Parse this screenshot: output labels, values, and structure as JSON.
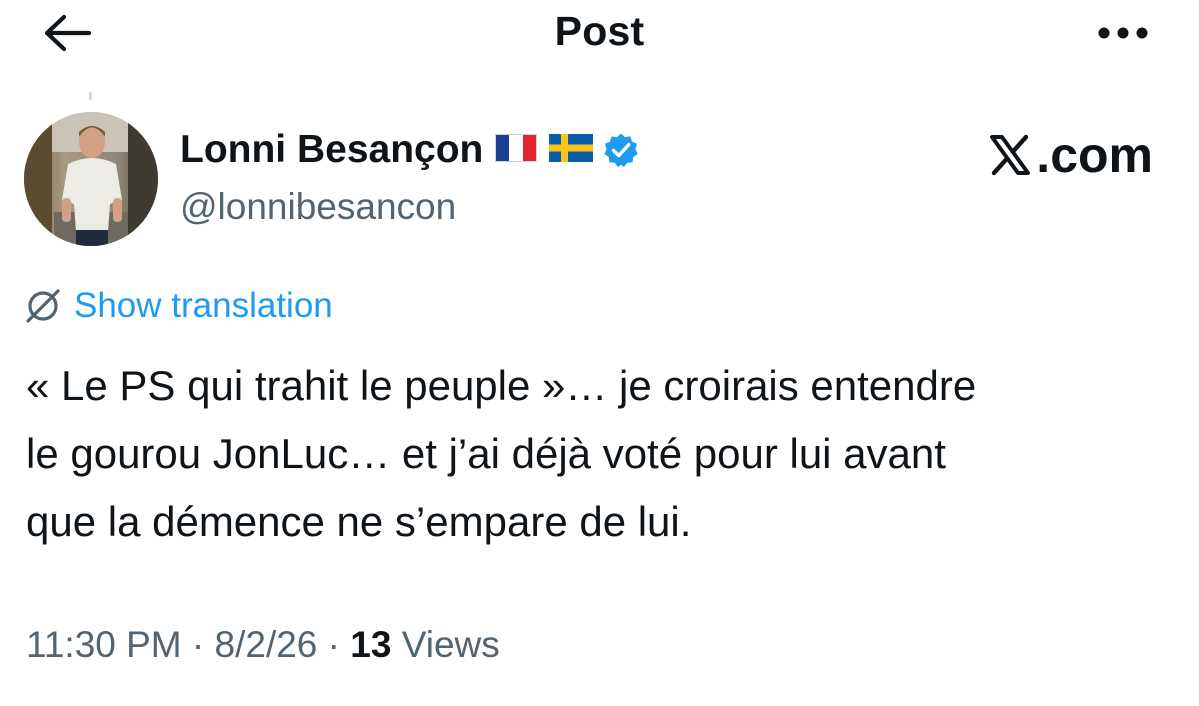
{
  "header": {
    "title": "Post",
    "back_icon": "arrow-left-icon",
    "more_icon": "more-horizontal-icon"
  },
  "author": {
    "name": "Lonni Besançon",
    "handle": "@lonnibesancon",
    "flags": [
      "france-flag-icon",
      "sweden-flag-icon"
    ],
    "verified_icon": "verified-badge-icon",
    "verified_color": "#1d9bf0"
  },
  "branding": {
    "site_label": ".com",
    "logo_icon": "x-logo-icon"
  },
  "translation": {
    "label": "Show translation",
    "icon": "globe-slash-icon",
    "color": "#1d9bf0"
  },
  "post": {
    "lines": [
      "« Le PS qui trahit le peuple »… je croirais entendre",
      "le gourou JonLuc… et j’ai déjà voté pour lui avant",
      "que la démence ne s’empare de lui."
    ]
  },
  "meta": {
    "time": "11:30 PM",
    "date": "8/2/26",
    "separator": "·",
    "views_count": "13",
    "views_label": "Views"
  },
  "colors": {
    "text": "#0f1419",
    "secondary": "#536471",
    "accent": "#1d9bf0"
  }
}
